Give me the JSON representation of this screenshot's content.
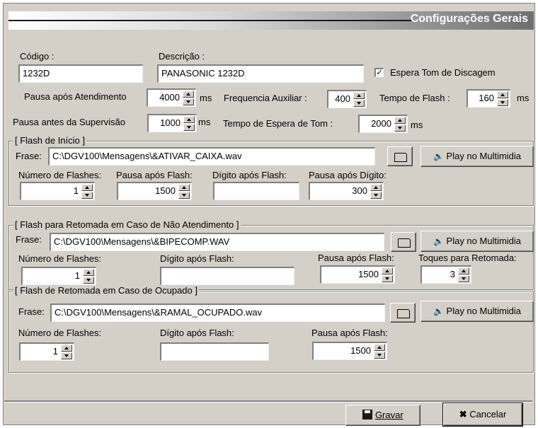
{
  "header": {
    "title": "Configurações Gerais"
  },
  "general": {
    "codigo_label": "Código :",
    "codigo_value": "1232D",
    "descricao_label": "Descrição :",
    "descricao_value": "PANASONIC 1232D",
    "espera_tom_label": "Espera Tom de Discagem",
    "espera_tom_checked": true,
    "pausa_atend_label": "Pausa após Atendimento",
    "pausa_atend_value": "4000",
    "freq_aux_label": "Frequencia Auxiliar :",
    "freq_aux_value": "400",
    "tempo_flash_label": "Tempo de Flash :",
    "tempo_flash_value": "160",
    "pausa_sup_label": "Pausa antes da Supervisão",
    "pausa_sup_value": "1000",
    "tempo_espera_label": "Tempo de Espera de Tom :",
    "tempo_espera_value": "2000",
    "ms": "ms"
  },
  "flash_inicio": {
    "title": "[ Flash de Início ]",
    "frase_label": "Frase:",
    "frase_value": "C:\\DGV100\\Mensagens\\&ATIVAR_CAIXA.wav",
    "play_label": "Play no Multimidia",
    "num_flashes_label": "Número de Flashes:",
    "num_flashes_value": "1",
    "pausa_flash_label": "Pausa após Flash:",
    "pausa_flash_value": "1500",
    "digito_label": "Dígito após Flash:",
    "digito_value": "",
    "pausa_digito_label": "Pausa após Dígito:",
    "pausa_digito_value": "300"
  },
  "flash_retomada": {
    "title": "[ Flash para Retomada em Caso de Não Atendimento ]",
    "frase_label": "Frase:",
    "frase_value": "C:\\DGV100\\Mensagens\\&BIPECOMP.WAV",
    "play_label": "Play no Multimidia",
    "num_flashes_label": "Número de Flashes:",
    "num_flashes_value": "1",
    "digito_label": "Dígito após Flash:",
    "digito_value": "",
    "pausa_flash_label": "Pausa após Flash:",
    "pausa_flash_value": "1500",
    "toques_label": "Toques para Retomada:",
    "toques_value": "3"
  },
  "flash_ocupado": {
    "title": "[ Flash de Retomada em Caso de Ocupado ]",
    "frase_label": "Frase:",
    "frase_value": "C:\\DGV100\\Mensagens\\&RAMAL_OCUPADO.wav",
    "play_label": "Play no Multimidia",
    "num_flashes_label": "Número de Flashes:",
    "num_flashes_value": "1",
    "digito_label": "Dígito após Flash:",
    "digito_value": "",
    "pausa_flash_label": "Pausa após Flash:",
    "pausa_flash_value": "1500"
  },
  "footer": {
    "gravar_label": "Gravar",
    "cancelar_label": "Cancelar"
  }
}
